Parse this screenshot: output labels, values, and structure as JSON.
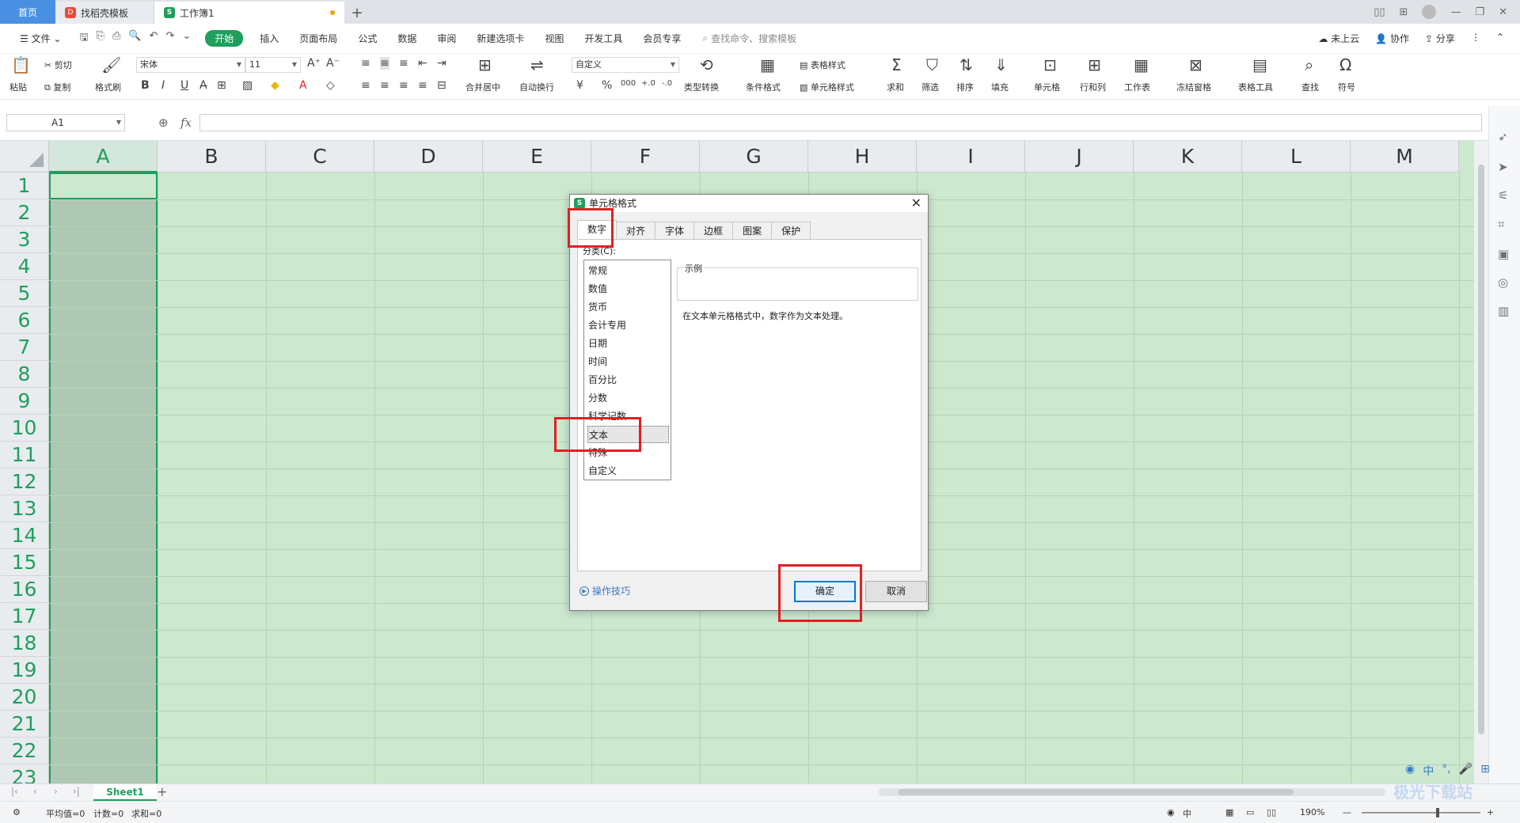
{
  "tabs": {
    "home": "首页",
    "template": "找稻壳模板",
    "workbook": "工作簿1",
    "add": "+"
  },
  "menu": {
    "file": "文件",
    "items": [
      "开始",
      "插入",
      "页面布局",
      "公式",
      "数据",
      "审阅",
      "新建选项卡",
      "视图",
      "开发工具",
      "会员专享"
    ],
    "search": "查找命令、搜索模板",
    "cloud": "未上云",
    "collab": "协作",
    "share": "分享"
  },
  "ribbon": {
    "paste": "粘贴",
    "cut": "剪切",
    "copy": "复制",
    "format_painter": "格式刷",
    "font_name": "宋体",
    "font_size": "11",
    "merge": "合并居中",
    "wrap": "自动换行",
    "number_format": "自定义",
    "type_convert": "类型转换",
    "cond_format": "条件格式",
    "table_style": "表格样式",
    "cell_style": "单元格样式",
    "sum": "求和",
    "filter": "筛选",
    "sort": "排序",
    "fill": "填充",
    "cell": "单元格",
    "row_col": "行和列",
    "worksheet": "工作表",
    "freeze": "冻结窗格",
    "table_tools": "表格工具",
    "find": "查找",
    "symbol": "符号"
  },
  "formula_bar": {
    "name_box": "A1",
    "fx": "fx",
    "value": ""
  },
  "grid": {
    "columns": [
      "A",
      "B",
      "C",
      "D",
      "E",
      "F",
      "G",
      "H",
      "I",
      "J",
      "K",
      "L",
      "M"
    ],
    "rows": [
      "1",
      "2",
      "3",
      "4",
      "5",
      "6",
      "7",
      "8",
      "9",
      "10",
      "11",
      "12",
      "13",
      "14",
      "15",
      "16",
      "17",
      "18",
      "19",
      "20",
      "21",
      "22",
      "23"
    ]
  },
  "sheet": {
    "name": "Sheet1"
  },
  "status": {
    "avg": "平均值=0",
    "count": "计数=0",
    "sum": "求和=0",
    "zoom": "190%"
  },
  "dialog": {
    "title": "单元格格式",
    "tabs": [
      "数字",
      "对齐",
      "字体",
      "边框",
      "图案",
      "保护"
    ],
    "category_label": "分类(C):",
    "categories": [
      "常规",
      "数值",
      "货币",
      "会计专用",
      "日期",
      "时间",
      "百分比",
      "分数",
      "科学记数",
      "文本",
      "特殊",
      "自定义"
    ],
    "selected_category": "文本",
    "sample_label": "示例",
    "description": "在文本单元格格式中，数字作为文本处理。",
    "tips": "操作技巧",
    "ok": "确定",
    "cancel": "取消"
  },
  "ime": {
    "lang": "中"
  },
  "watermark": "极光下载站"
}
